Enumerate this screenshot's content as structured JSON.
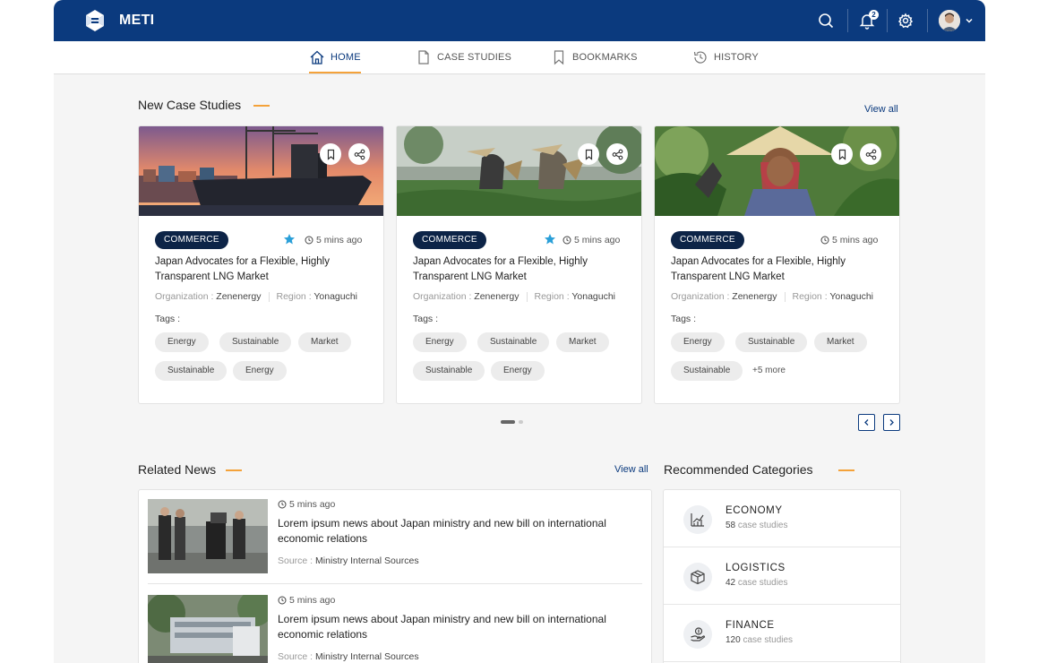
{
  "app": {
    "name": "METI"
  },
  "header": {
    "notification_count": "2",
    "icons": [
      "search-icon",
      "bell-icon",
      "gear-icon",
      "avatar",
      "chevron-down-icon"
    ]
  },
  "nav": {
    "tabs": [
      {
        "label": "HOME",
        "icon": "home-icon",
        "active": true
      },
      {
        "label": "CASE STUDIES",
        "icon": "document-icon",
        "active": false
      },
      {
        "label": "BOOKMARKS",
        "icon": "bookmark-icon",
        "active": false
      },
      {
        "label": "HISTORY",
        "icon": "history-icon",
        "active": false
      }
    ]
  },
  "case_studies": {
    "title": "New Case Studies",
    "view_all": "View all",
    "cards": [
      {
        "badge": "COMMERCE",
        "starred": true,
        "time": "5 mins ago",
        "title": "Japan Advocates for a Flexible, Highly Transparent LNG Market",
        "org_label": "Organization :",
        "org": "Zenenergy",
        "region_label": "Region :",
        "region": "Yonaguchi",
        "tags_label": "Tags :",
        "tags": [
          "Energy",
          "Sustainable",
          "Market",
          "Sustainable",
          "Energy"
        ],
        "more": ""
      },
      {
        "badge": "COMMERCE",
        "starred": true,
        "time": "5 mins ago",
        "title": "Japan Advocates for a Flexible, Highly Transparent LNG Market",
        "org_label": "Organization :",
        "org": "Zenenergy",
        "region_label": "Region :",
        "region": "Yonaguchi",
        "tags_label": "Tags :",
        "tags": [
          "Energy",
          "Sustainable",
          "Market",
          "Sustainable",
          "Energy"
        ],
        "more": ""
      },
      {
        "badge": "COMMERCE",
        "starred": false,
        "time": "5 mins ago",
        "title": "Japan Advocates for a Flexible, Highly Transparent LNG Market",
        "org_label": "Organization :",
        "org": "Zenenergy",
        "region_label": "Region :",
        "region": "Yonaguchi",
        "tags_label": "Tags :",
        "tags": [
          "Energy",
          "Sustainable",
          "Market",
          "Sustainable"
        ],
        "more": "+5 more"
      }
    ],
    "pagination": {
      "pages": 2,
      "current": 1
    }
  },
  "related_news": {
    "title": "Related News",
    "view_all": "View all",
    "items": [
      {
        "time": "5 mins ago",
        "title": "Lorem ipsum news about Japan ministry and new bill on international economic relations",
        "source_label": "Source :",
        "source": "Ministry Internal Sources"
      },
      {
        "time": "5 mins ago",
        "title": "Lorem ipsum news about Japan ministry and new bill on international economic relations",
        "source_label": "Source :",
        "source": "Ministry Internal Sources"
      }
    ]
  },
  "categories": {
    "title": "Recommended Categories",
    "items": [
      {
        "name": "ECONOMY",
        "count": "58",
        "suffix": "case studies",
        "icon": "chart-icon"
      },
      {
        "name": "LOGISTICS",
        "count": "42",
        "suffix": "case studies",
        "icon": "box-icon"
      },
      {
        "name": "FINANCE",
        "count": "120",
        "suffix": "case studies",
        "icon": "money-hand-icon"
      }
    ]
  },
  "colors": {
    "brand": "#0b3a7e",
    "accent": "#f4a23a",
    "badge": "#0d2447",
    "star": "#2a9fd8"
  }
}
